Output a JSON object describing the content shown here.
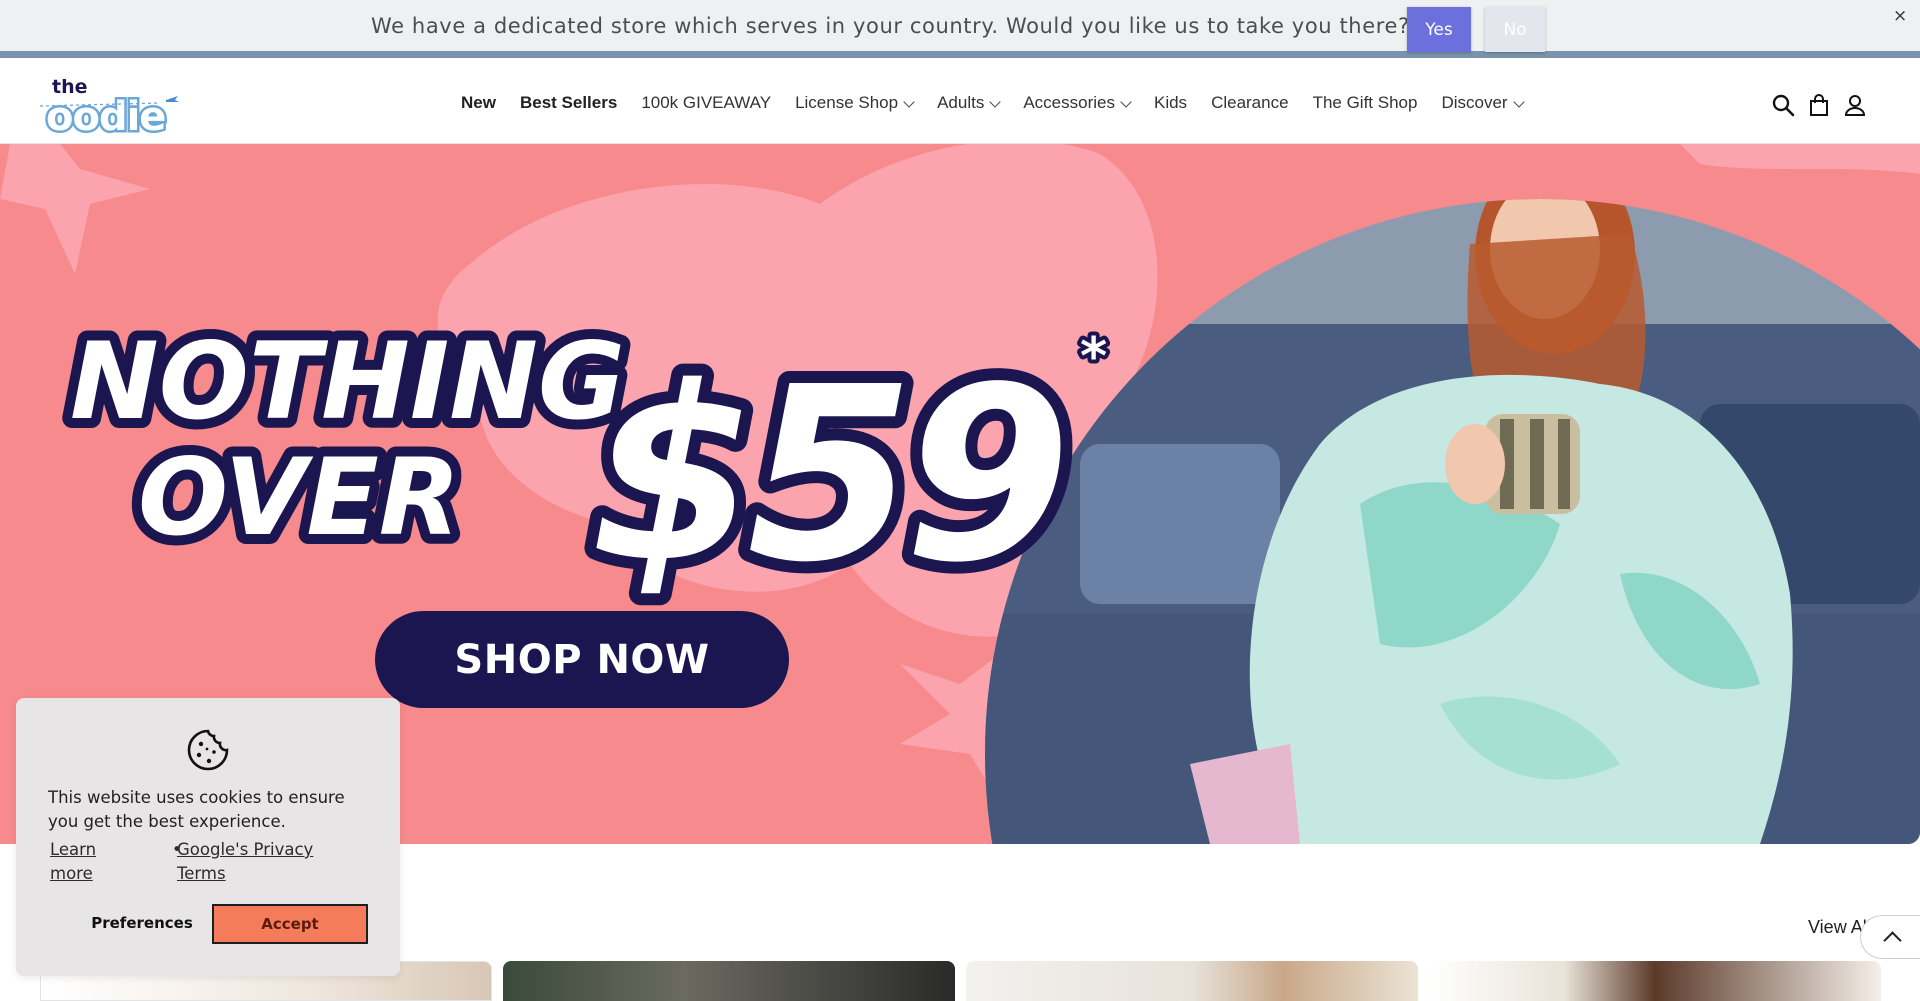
{
  "store_banner": {
    "message": "We have a dedicated store which serves in your country. Would you like us to take you there?",
    "yes_label": "Yes",
    "no_label": "No",
    "close_label": "×"
  },
  "header": {
    "logo_text_top": "the",
    "logo_text_main": "oodie",
    "nav": [
      {
        "label": "New",
        "bold": true,
        "dropdown": false
      },
      {
        "label": "Best Sellers",
        "bold": true,
        "dropdown": false
      },
      {
        "label": "100k GIVEAWAY",
        "bold": false,
        "dropdown": false
      },
      {
        "label": "License Shop",
        "bold": false,
        "dropdown": true
      },
      {
        "label": "Adults",
        "bold": false,
        "dropdown": true
      },
      {
        "label": "Accessories",
        "bold": false,
        "dropdown": true
      },
      {
        "label": "Kids",
        "bold": false,
        "dropdown": false
      },
      {
        "label": "Clearance",
        "bold": false,
        "dropdown": false
      },
      {
        "label": "The Gift Shop",
        "bold": false,
        "dropdown": false
      },
      {
        "label": "Discover",
        "bold": false,
        "dropdown": true
      }
    ],
    "icons": [
      "search-icon",
      "cart-icon",
      "account-icon"
    ]
  },
  "hero": {
    "line1": "NOTHING",
    "line2": "OVER",
    "price": "$59",
    "asterisk": "*",
    "cta_label": "SHOP NOW",
    "colors": {
      "background": "#f78a8d",
      "shape": "#fba4ae",
      "navy": "#1c1650"
    }
  },
  "section": {
    "view_all_label": "View All"
  },
  "cookie": {
    "text": "This website uses cookies to ensure you get the best experience.",
    "learn_more": "Learn more",
    "separator": "•",
    "privacy": "Google's Privacy Terms",
    "preferences_label": "Preferences",
    "accept_label": "Accept",
    "accent": "#f47c5b"
  }
}
